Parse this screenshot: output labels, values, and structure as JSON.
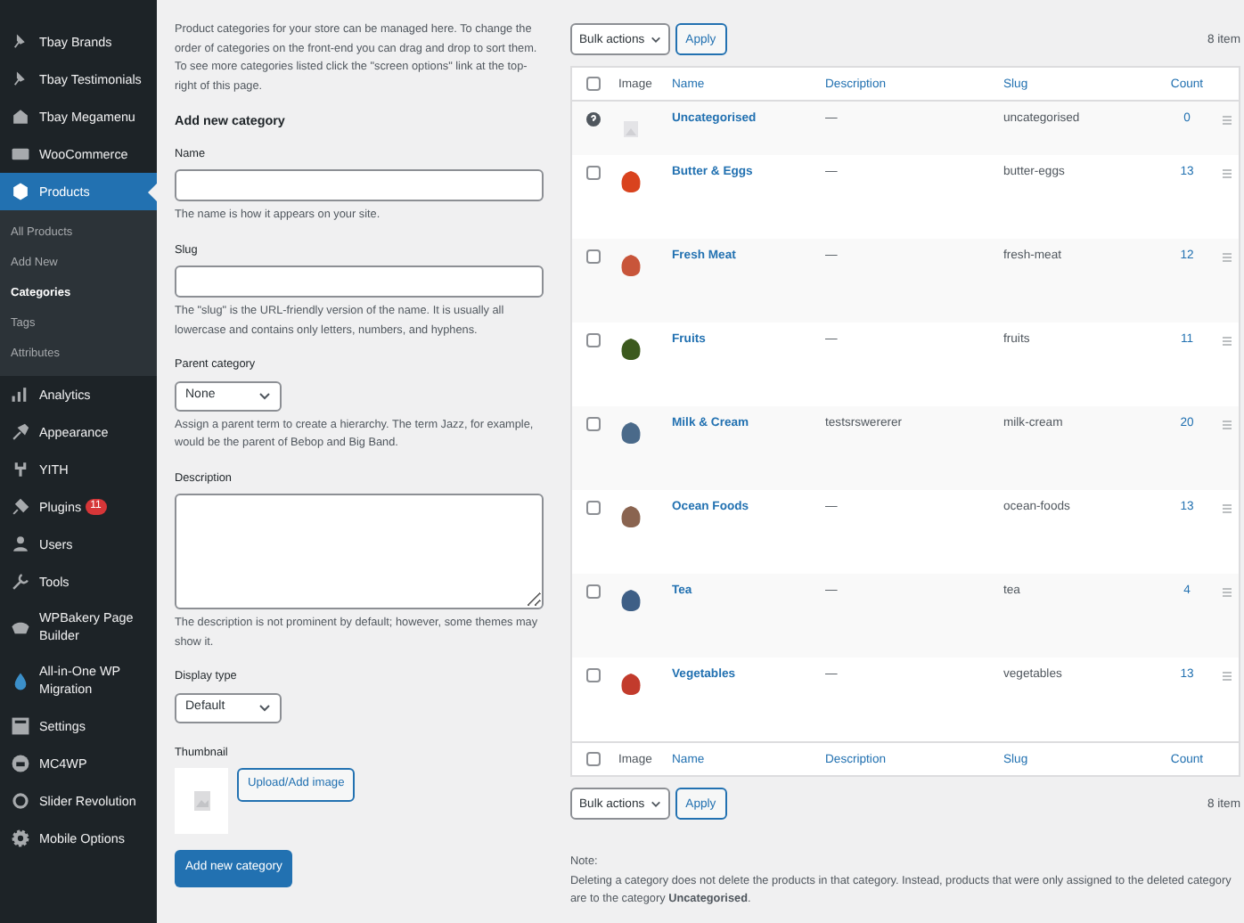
{
  "sidebar": {
    "items": [
      {
        "label": "Tbay Brands",
        "selected": false
      },
      {
        "label": "Tbay Testimonials",
        "selected": false
      },
      {
        "label": "Tbay Megamenu",
        "selected": false
      },
      {
        "label": "WooCommerce",
        "selected": false
      },
      {
        "label": "Products",
        "selected": true,
        "children": [
          {
            "label": "All Products",
            "selected": false
          },
          {
            "label": "Add New",
            "selected": false
          },
          {
            "label": "Categories",
            "selected": true
          },
          {
            "label": "Tags",
            "selected": false
          },
          {
            "label": "Attributes",
            "selected": false
          }
        ]
      },
      {
        "label": "Analytics",
        "selected": false
      },
      {
        "label": "Appearance",
        "selected": false
      },
      {
        "label": "YITH",
        "selected": false
      },
      {
        "label": "Plugins",
        "selected": false,
        "badge": "11"
      },
      {
        "label": "Users",
        "selected": false
      },
      {
        "label": "Tools",
        "selected": false
      },
      {
        "label": "WPBakery Page Builder",
        "selected": false
      },
      {
        "label": "All-in-One WP Migration",
        "selected": false
      },
      {
        "label": "Settings",
        "selected": false
      },
      {
        "label": "MC4WP",
        "selected": false
      },
      {
        "label": "Slider Revolution",
        "selected": false
      },
      {
        "label": "Mobile Options",
        "selected": false
      }
    ]
  },
  "form": {
    "intro": "Product categories for your store can be managed here. To change the order of categories on the front-end you can drag and drop to sort them. To see more categories listed click the \"screen options\" link at the top-right of this page.",
    "heading": "Add new category",
    "fields": [
      {
        "kind": "text",
        "label": "Name",
        "help": "The name is how it appears on your site."
      },
      {
        "kind": "text",
        "label": "Slug",
        "help": "The \"slug\" is the URL-friendly version of the name. It is usually all lowercase and contains only letters, numbers, and hyphens."
      },
      {
        "kind": "select",
        "label": "Parent category",
        "value": "None",
        "help": "Assign a parent term to create a hierarchy. The term Jazz, for example, would be the parent of Bebop and Big Band."
      },
      {
        "kind": "textarea",
        "label": "Description",
        "help": "The description is not prominent by default; however, some themes may show it."
      },
      {
        "kind": "select",
        "label": "Display type",
        "value": "Default"
      },
      {
        "kind": "thumbnail",
        "label": "Thumbnail",
        "button": "Upload/Add image"
      }
    ],
    "submit": "Add new category"
  },
  "table": {
    "bulk_actions": "Bulk actions",
    "apply": "Apply",
    "count": "8 item",
    "select_all_checked": false,
    "columns": [
      "Image",
      "Name",
      "Description",
      "Slug",
      "Count"
    ],
    "rows": [
      {
        "kind": "default",
        "name": "Uncategorised",
        "description": "—",
        "slug": "uncategorised",
        "count": "0"
      },
      {
        "kind": "checkbox",
        "checked": false,
        "color": "#d9431e",
        "name": "Butter & Eggs",
        "description": "—",
        "slug": "butter-eggs",
        "count": "13"
      },
      {
        "kind": "checkbox",
        "checked": false,
        "color": "#c8553a",
        "name": "Fresh Meat",
        "description": "—",
        "slug": "fresh-meat",
        "count": "12"
      },
      {
        "kind": "checkbox",
        "checked": false,
        "color": "#3c5a1e",
        "name": "Fruits",
        "description": "—",
        "slug": "fruits",
        "count": "11"
      },
      {
        "kind": "checkbox",
        "checked": false,
        "color": "#4a6a8a",
        "name": "Milk & Cream",
        "description": "testsrswererer",
        "slug": "milk-cream",
        "count": "20"
      },
      {
        "kind": "checkbox",
        "checked": false,
        "color": "#8a6450",
        "name": "Ocean Foods",
        "description": "—",
        "slug": "ocean-foods",
        "count": "13"
      },
      {
        "kind": "checkbox",
        "checked": false,
        "color": "#3e5f86",
        "name": "Tea",
        "description": "—",
        "slug": "tea",
        "count": "4"
      },
      {
        "kind": "checkbox",
        "checked": false,
        "color": "#c23b2c",
        "name": "Vegetables",
        "description": "—",
        "slug": "vegetables",
        "count": "13"
      }
    ],
    "footer_select_all_checked": false,
    "footer_columns": [
      "Image",
      "Name",
      "Description",
      "Slug",
      "Count"
    ],
    "bottom_bulk_actions": "Bulk actions",
    "bottom_apply": "Apply",
    "bottom_count": "8 item"
  },
  "note": {
    "title": "Note:",
    "text": "Deleting a category does not delete the products in that category. Instead, products that were only assigned to the deleted category are to the category **Uncategorised**."
  }
}
